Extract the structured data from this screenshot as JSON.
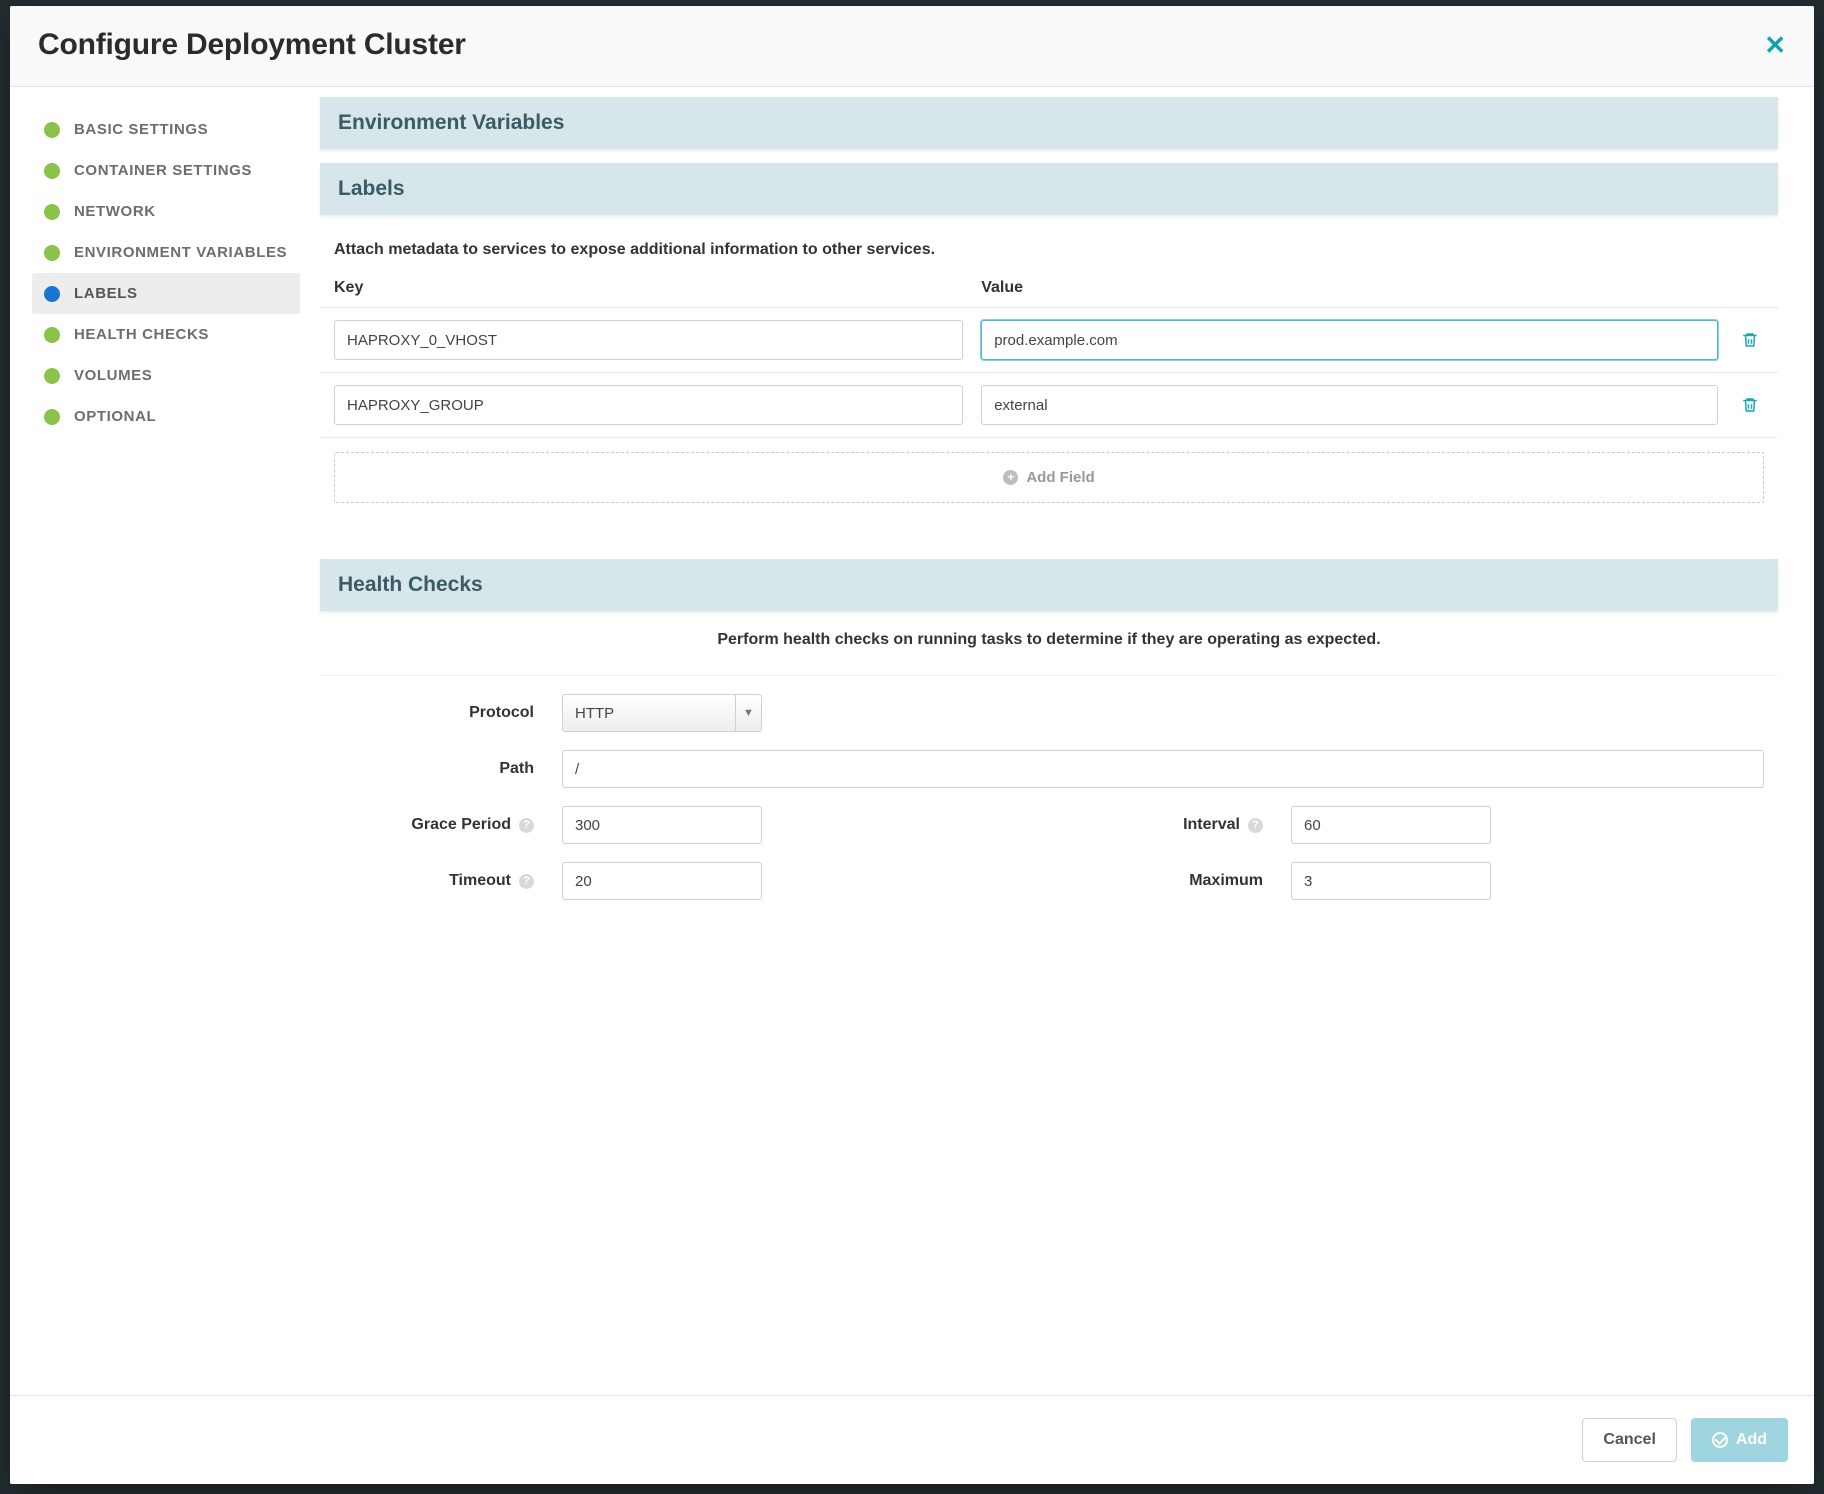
{
  "modal": {
    "title": "Configure Deployment Cluster"
  },
  "sidebar": {
    "items": [
      {
        "label": "Basic Settings",
        "active": false
      },
      {
        "label": "Container Settings",
        "active": false
      },
      {
        "label": "Network",
        "active": false
      },
      {
        "label": "Environment Variables",
        "active": false
      },
      {
        "label": "Labels",
        "active": true
      },
      {
        "label": "Health Checks",
        "active": false
      },
      {
        "label": "Volumes",
        "active": false
      },
      {
        "label": "Optional",
        "active": false
      }
    ]
  },
  "sections": {
    "env_vars": {
      "title": "Environment Variables"
    },
    "labels": {
      "title": "Labels",
      "description": "Attach metadata to services to expose additional information to other services.",
      "columns": {
        "key": "Key",
        "value": "Value"
      },
      "rows": [
        {
          "key": "HAPROXY_0_VHOST",
          "value": "prod.example.com",
          "focused": true
        },
        {
          "key": "HAPROXY_GROUP",
          "value": "external",
          "focused": false
        }
      ],
      "add_field": "Add Field"
    },
    "health": {
      "title": "Health Checks",
      "description": "Perform health checks on running tasks to determine if they are operating as expected.",
      "protocol": {
        "label": "Protocol",
        "value": "HTTP"
      },
      "path": {
        "label": "Path",
        "value": "/"
      },
      "grace": {
        "label": "Grace Period",
        "value": "300"
      },
      "interval": {
        "label": "Interval",
        "value": "60"
      },
      "timeout": {
        "label": "Timeout",
        "value": "20"
      },
      "max": {
        "label": "Maximum",
        "value": "3"
      }
    }
  },
  "footer": {
    "cancel": "Cancel",
    "add": "Add"
  }
}
